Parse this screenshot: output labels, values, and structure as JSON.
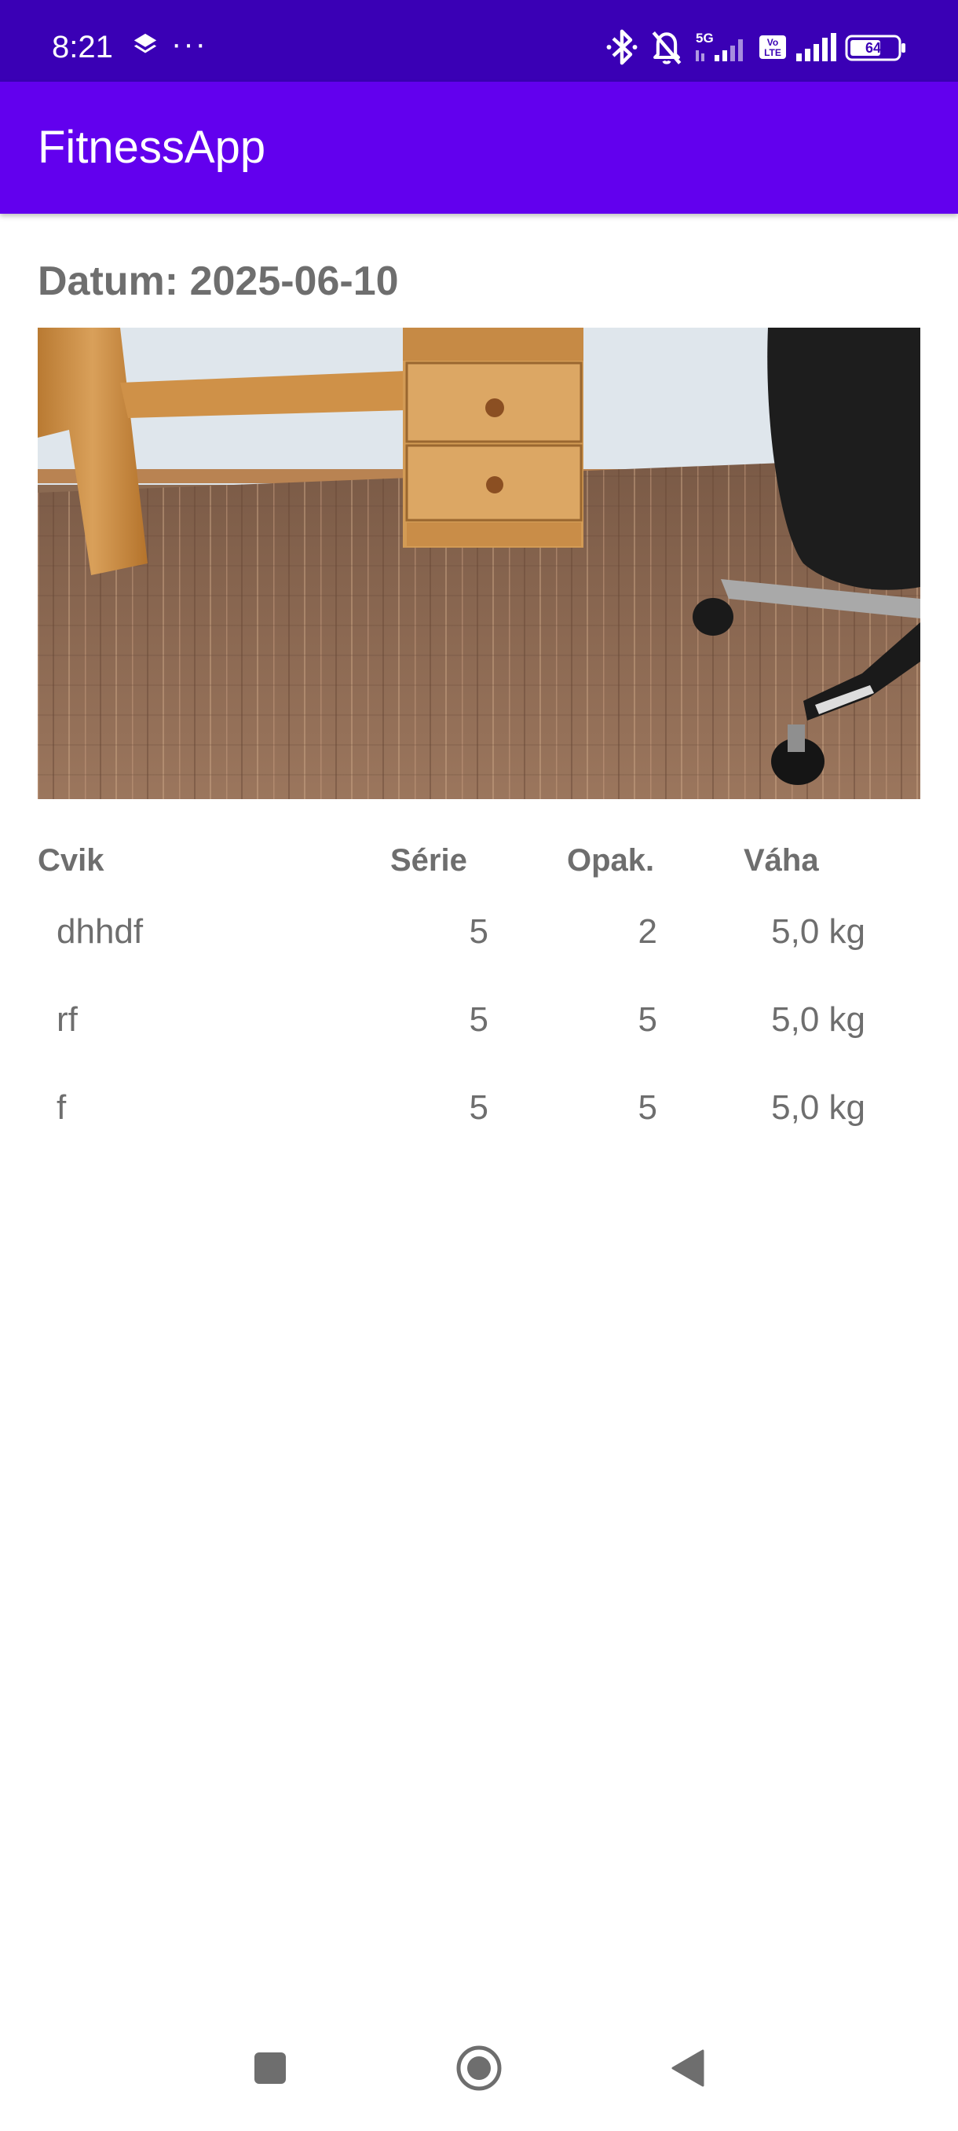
{
  "status_bar": {
    "time": "8:21",
    "more": "···",
    "icons": [
      "layers-icon",
      "bluetooth-icon",
      "bell-off-icon",
      "5g-signal-icon",
      "volte-icon",
      "cell-signal-icon",
      "battery-icon"
    ],
    "network_label": "5G",
    "volte_label_top": "Vo",
    "volte_label_bottom": "LTE",
    "battery_level": "64"
  },
  "app_bar": {
    "title": "FitnessApp",
    "color": "#6200ee"
  },
  "workout": {
    "date_label": "Datum: ",
    "date_value": "2025-06-10"
  },
  "table": {
    "headers": {
      "name": "Cvik",
      "sets": "Série",
      "reps": "Opak.",
      "weight": "Váha"
    },
    "rows": [
      {
        "name": "dhhdf",
        "sets": "5",
        "reps": "2",
        "weight": "5,0 kg"
      },
      {
        "name": "rf",
        "sets": "5",
        "reps": "5",
        "weight": "5,0 kg"
      },
      {
        "name": "f",
        "sets": "5",
        "reps": "5",
        "weight": "5,0 kg"
      }
    ]
  },
  "nav_bar": {
    "icons": [
      "recents-square-icon",
      "home-circle-icon",
      "back-triangle-icon"
    ]
  },
  "colors": {
    "status_bar": "#3a00b5",
    "app_bar": "#6200ee",
    "text": "#6e6e6e"
  }
}
